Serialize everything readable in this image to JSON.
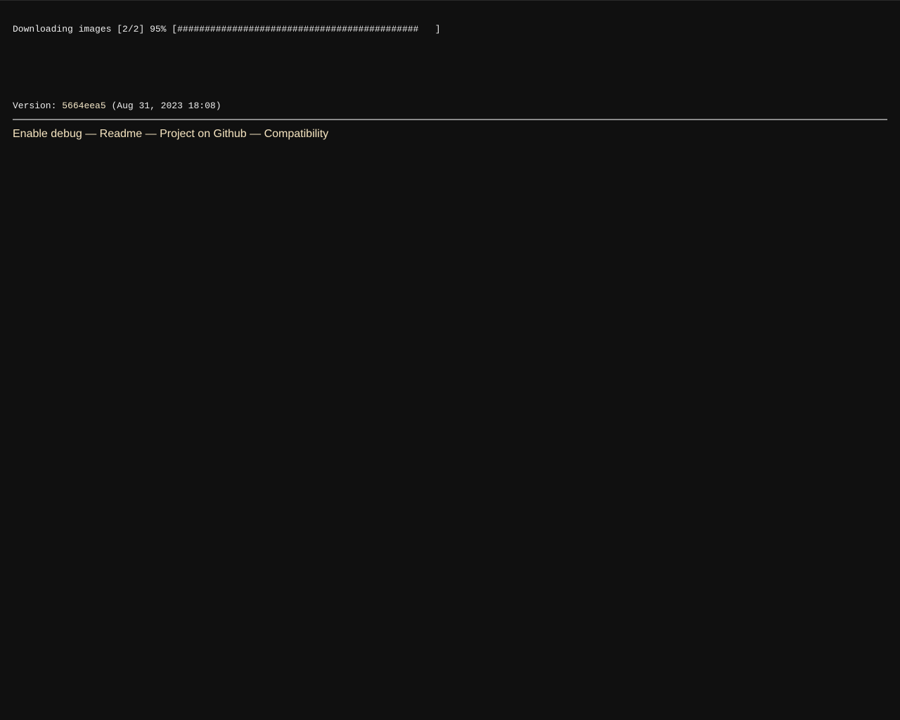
{
  "progress": {
    "label": "Downloading images",
    "counter": "[2/2]",
    "percent_text": "95%",
    "fraction": 0.95,
    "bar_text": "[############################################   ]"
  },
  "version": {
    "label": "Version:",
    "hash": "5664eea5",
    "date": "(Aug 31, 2023 18:08)"
  },
  "footer": {
    "links": [
      {
        "label": "Enable debug"
      },
      {
        "label": "Readme"
      },
      {
        "label": "Project on Github"
      },
      {
        "label": "Compatibility"
      }
    ],
    "separator": "—"
  },
  "colors": {
    "background": "#101010",
    "text": "#ececec",
    "link": "#f5e4c0",
    "divider": "#8a8a8a"
  }
}
